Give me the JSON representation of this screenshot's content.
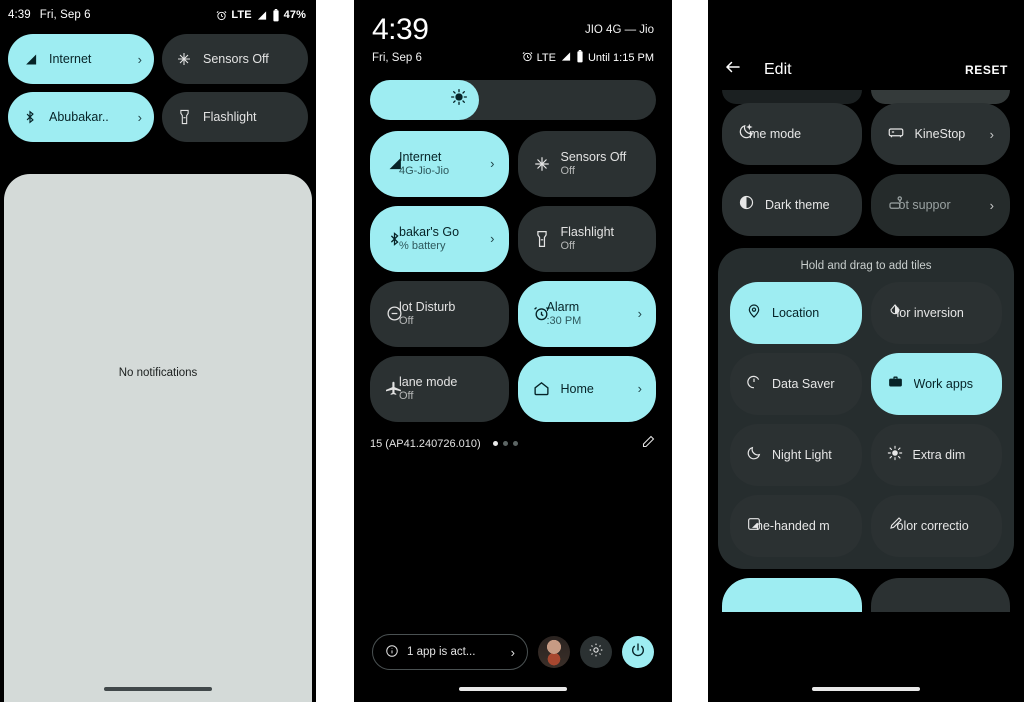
{
  "panel1": {
    "statusbar": {
      "time": "4:39",
      "date": "Fri, Sep 6",
      "network": "LTE",
      "battery": "47%",
      "alarm_icon": "alarm-clock-icon",
      "signal_icon": "signal-bars-icon",
      "battery_icon": "battery-icon"
    },
    "tiles": [
      {
        "label": "Internet",
        "state": "on",
        "icon": "signal-internet-icon",
        "chevron": "›"
      },
      {
        "label": "Sensors Off",
        "state": "off",
        "icon": "sensors-off-icon",
        "chevron": ""
      },
      {
        "label": "Abubakar..",
        "state": "on",
        "icon": "bluetooth-icon",
        "chevron": "›"
      },
      {
        "label": "Flashlight",
        "state": "off",
        "icon": "flashlight-icon",
        "chevron": ""
      }
    ],
    "shade": {
      "empty_text": "No notifications"
    }
  },
  "panel2": {
    "header": {
      "time": "4:39",
      "date": "Fri, Sep 6",
      "carrier": "JIO 4G — Jio",
      "network": "LTE",
      "battery_status": "Until 1:15 PM"
    },
    "brightness": {
      "icon": "brightness-icon",
      "level_percent": 38
    },
    "tiles": [
      {
        "label": "Internet",
        "sub": "4G-Jio-Jio",
        "state": "on",
        "icon": "signal-internet-icon",
        "chevron": "›",
        "clipped": true
      },
      {
        "label": "Sensors Off",
        "sub": "Off",
        "state": "off",
        "icon": "sensors-off-icon",
        "chevron": "",
        "clipped": false
      },
      {
        "label": "bakar's Go",
        "sub": "% battery",
        "state": "on",
        "icon": "bluetooth-icon",
        "chevron": "›",
        "clipped": true
      },
      {
        "label": "Flashlight",
        "sub": "Off",
        "state": "off",
        "icon": "flashlight-icon",
        "chevron": "",
        "clipped": false
      },
      {
        "label": "lot Disturb",
        "sub": "Off",
        "state": "off",
        "icon": "do-not-disturb-icon",
        "chevron": "",
        "clipped": true
      },
      {
        "label": "Alarm",
        "sub": ":30 PM",
        "state": "on",
        "icon": "alarm-clock-icon",
        "chevron": "›",
        "clipped": true
      },
      {
        "label": "lane mode",
        "sub": "Off",
        "state": "off",
        "icon": "airplane-icon",
        "chevron": "",
        "clipped": true
      },
      {
        "label": "Home",
        "sub": "",
        "state": "on",
        "icon": "home-icon",
        "chevron": "›",
        "clipped": false
      }
    ],
    "footer": {
      "build": "15 (AP41.240726.010)",
      "page_dots": 3,
      "active_dot": 0,
      "edit_icon": "pencil-edit-icon"
    },
    "bottom": {
      "active_apps": "1 app is act...",
      "active_apps_icon": "info-circle-icon",
      "active_apps_chevron": "›",
      "avatar": "user-avatar",
      "settings_icon": "gear-icon",
      "power_icon": "power-icon"
    }
  },
  "panel3": {
    "header": {
      "back_icon": "back-arrow-icon",
      "title": "Edit",
      "reset": "RESET"
    },
    "current_tiles": [
      {
        "label": "me mode",
        "icon": "bedtime-moon-icon",
        "chevron": "",
        "clipped": true,
        "dim": false
      },
      {
        "label": "KineStop",
        "icon": "car-seat-icon",
        "chevron": "›",
        "clipped": false,
        "dim": false
      },
      {
        "label": "Dark theme",
        "icon": "dark-theme-icon",
        "chevron": "",
        "clipped": false,
        "dim": false
      },
      {
        "label": "ot suppor",
        "icon": "car-key-icon",
        "chevron": "›",
        "clipped": true,
        "dim": true
      }
    ],
    "add_section": {
      "title": "Hold and drag to add tiles",
      "tiles": [
        {
          "label": "Location",
          "icon": "location-pin-icon",
          "state": "on",
          "clipped": false
        },
        {
          "label": "lor inversion",
          "icon": "color-inversion-icon",
          "state": "off",
          "clipped": true
        },
        {
          "label": "Data Saver",
          "icon": "data-saver-icon",
          "state": "off",
          "clipped": false
        },
        {
          "label": "Work apps",
          "icon": "briefcase-icon",
          "state": "on",
          "clipped": false
        },
        {
          "label": "Night Light",
          "icon": "night-light-icon",
          "state": "off",
          "clipped": false
        },
        {
          "label": "Extra dim",
          "icon": "extra-dim-icon",
          "state": "off",
          "clipped": false
        },
        {
          "label": "ne-handed m",
          "icon": "one-handed-icon",
          "state": "off",
          "clipped": true
        },
        {
          "label": "olor correctio",
          "icon": "color-correction-icon",
          "state": "off",
          "clipped": true
        }
      ]
    }
  },
  "colors": {
    "accent_cyan": "#9EEDF2",
    "tile_dark": "#2B3132",
    "tile_dim": "#252B2B",
    "background": "#000000",
    "shade_bg": "#D4DAD8",
    "text_on_cyan": "#062327"
  }
}
